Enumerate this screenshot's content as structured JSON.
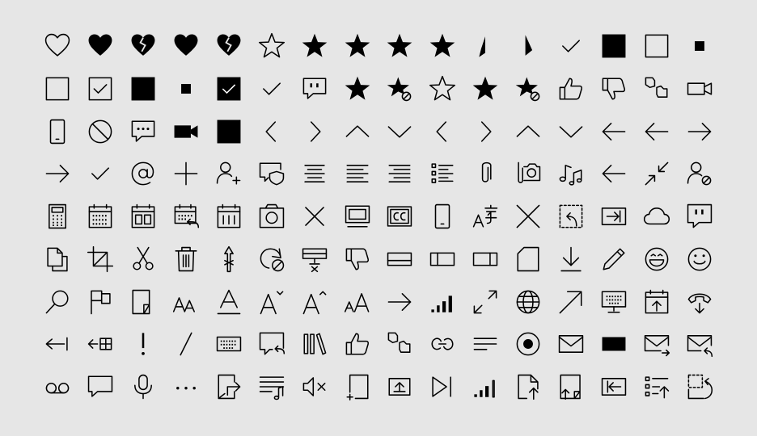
{
  "icon_color": "#000000",
  "background_color": "#e6e6e6",
  "rows": [
    [
      "heart-outline",
      "heart-filled",
      "heart-broken",
      "heart-filled",
      "heart-broken",
      "star-outline",
      "star-filled",
      "star-filled",
      "star-filled",
      "star-filled",
      "star-half",
      "star-half-left",
      "checkmark",
      "square-filled",
      "square-outline",
      "small-square-filled"
    ],
    [
      "checkbox-empty",
      "checkbox-checked",
      "square-filled",
      "small-square-filled",
      "checkbox-checked-filled",
      "checkmark",
      "message-quote",
      "star-filled",
      "star-off",
      "star-outline",
      "star-filled",
      "star-off",
      "like",
      "dislike",
      "like-dislike",
      "video"
    ],
    [
      "phone",
      "blocked",
      "message-more",
      "video-filled",
      "square-filled",
      "chevron-left",
      "chevron-right",
      "chevron-up",
      "chevron-down",
      "chevron-left",
      "chevron-right",
      "chevron-up",
      "chevron-down",
      "arrow-left",
      "arrow-left",
      "arrow-right"
    ],
    [
      "arrow-right",
      "checkmark",
      "at",
      "add",
      "add-friend",
      "shield-message",
      "align-center",
      "align-left",
      "align-right",
      "bulleted-list",
      "attach",
      "camera-attach",
      "music",
      "arrow-left",
      "shrink",
      "block-contact"
    ],
    [
      "calculator",
      "calendar-week",
      "calendar-day",
      "calendar-reply",
      "calendar",
      "camera",
      "close",
      "tv",
      "closed-caption",
      "phone",
      "translate",
      "cancel",
      "select-area",
      "go-to",
      "cloud",
      "comment-quote"
    ],
    [
      "copy",
      "crop",
      "cut",
      "delete",
      "directions",
      "sync-off",
      "dock-bottom-remove",
      "dislike",
      "dock-bottom",
      "dock-left",
      "dock-right",
      "document",
      "download",
      "edit",
      "emoji-laugh",
      "emoji"
    ],
    [
      "search",
      "flag",
      "page-fold",
      "font-size",
      "font-color",
      "font-decrease",
      "font-increase",
      "font-size-alt",
      "arrow-right",
      "signal-full",
      "full-screen",
      "globe",
      "arrow-up-right",
      "keyboard-screen",
      "calendar-import",
      "hang-up"
    ],
    [
      "arrow-left-end",
      "cell-insert",
      "important",
      "slash",
      "keyboard",
      "message-reply",
      "library",
      "like",
      "like-dislike",
      "link",
      "align-left-short",
      "radio-selected",
      "mail",
      "mail-filled",
      "mail-forward",
      "mail-reply"
    ],
    [
      "voicemail",
      "message",
      "microphone",
      "more",
      "door-exit",
      "playlist",
      "mute",
      "add-page",
      "share-screen",
      "next",
      "signal-low",
      "page-upload",
      "page-fold-upload",
      "back-to-window",
      "list-upload",
      "redo-area"
    ]
  ]
}
